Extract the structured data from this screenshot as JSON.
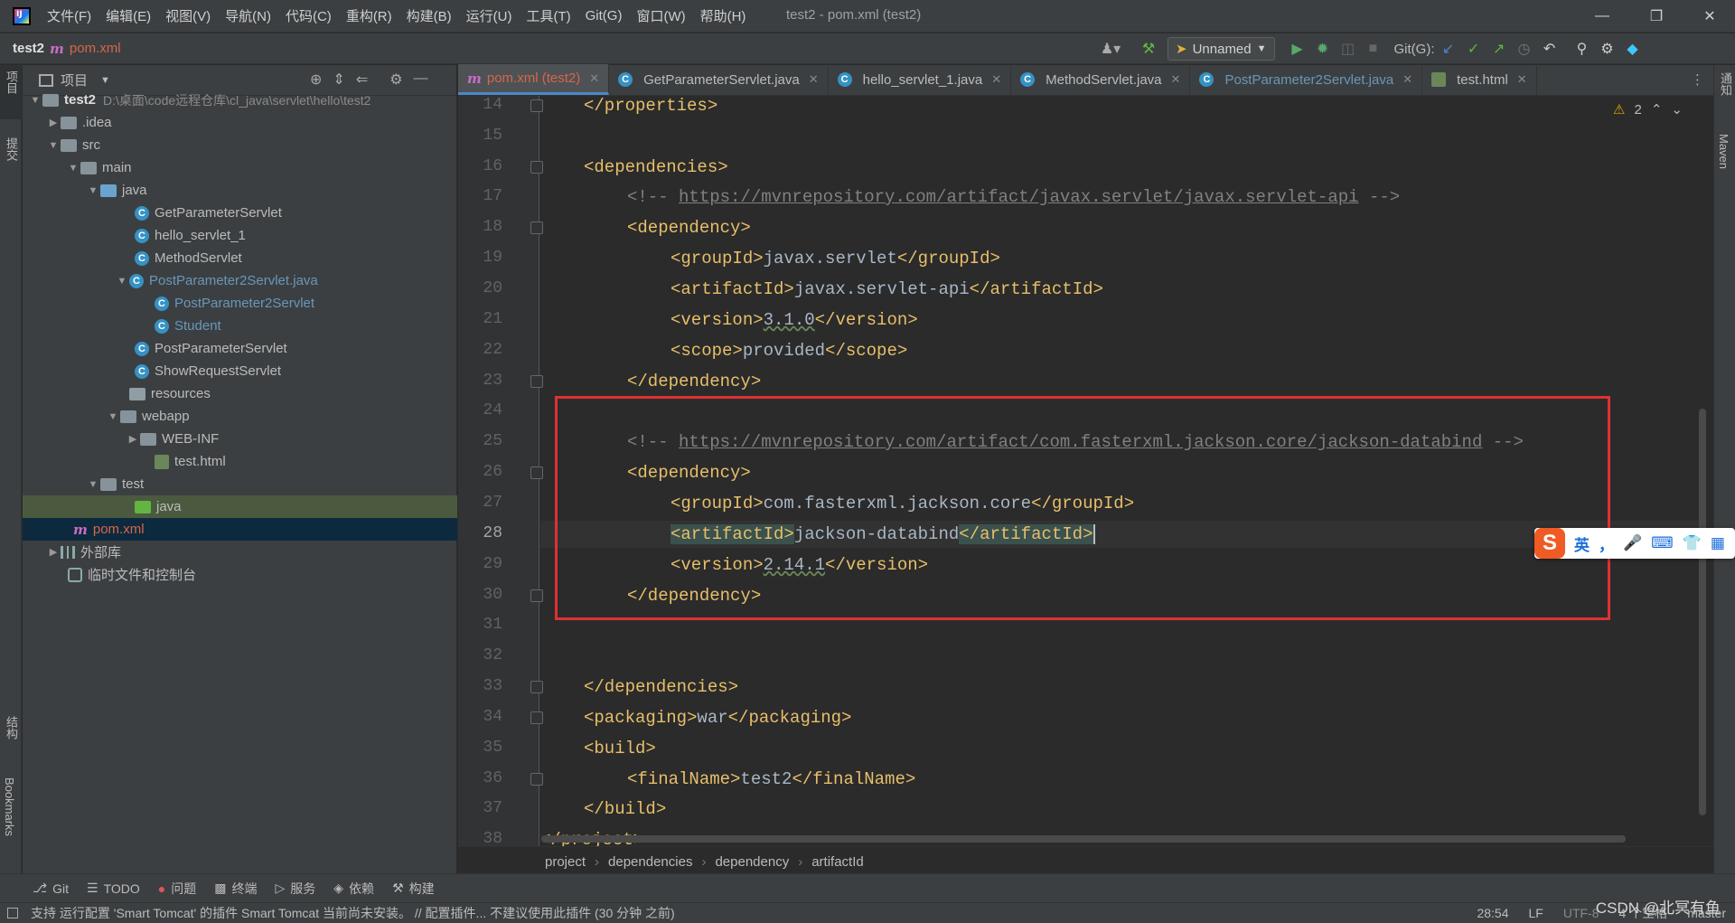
{
  "menubar": {
    "items": [
      "文件(F)",
      "编辑(E)",
      "视图(V)",
      "导航(N)",
      "代码(C)",
      "重构(R)",
      "构建(B)",
      "运行(U)",
      "工具(T)",
      "Git(G)",
      "窗口(W)",
      "帮助(H)"
    ],
    "title": "test2 - pom.xml (test2)"
  },
  "navbar": {
    "project": "test2",
    "file": "pom.xml",
    "run_config": "Unnamed",
    "git_label": "Git(G):"
  },
  "left_strip": {
    "project": "项目",
    "commit": "提交",
    "structure": "结构",
    "bookmarks": "Bookmarks"
  },
  "right_strip": {
    "notifications": "通知",
    "maven": "Maven"
  },
  "project_panel": {
    "title": "项目",
    "tree": [
      {
        "label": "test2",
        "path": "D:\\桌面\\code远程仓库\\cl_java\\servlet\\hello\\test2"
      },
      {
        "label": ".idea"
      },
      {
        "label": "src"
      },
      {
        "label": "main"
      },
      {
        "label": "java"
      },
      {
        "label": "GetParameterServlet"
      },
      {
        "label": "hello_servlet_1"
      },
      {
        "label": "MethodServlet"
      },
      {
        "label": "PostParameter2Servlet.java"
      },
      {
        "label": "PostParameter2Servlet"
      },
      {
        "label": "Student"
      },
      {
        "label": "PostParameterServlet"
      },
      {
        "label": "ShowRequestServlet"
      },
      {
        "label": "resources"
      },
      {
        "label": "webapp"
      },
      {
        "label": "WEB-INF"
      },
      {
        "label": "test.html"
      },
      {
        "label": "test"
      },
      {
        "label": "java"
      },
      {
        "label": "pom.xml"
      },
      {
        "label": "外部库"
      },
      {
        "label": "临时文件和控制台"
      }
    ]
  },
  "tabs": [
    {
      "label": "pom.xml (test2)"
    },
    {
      "label": "GetParameterServlet.java"
    },
    {
      "label": "hello_servlet_1.java"
    },
    {
      "label": "MethodServlet.java"
    },
    {
      "label": "PostParameter2Servlet.java"
    },
    {
      "label": "test.html"
    }
  ],
  "editor": {
    "warnings": "2",
    "line_numbers": [
      "14",
      "15",
      "16",
      "17",
      "18",
      "19",
      "20",
      "21",
      "22",
      "23",
      "24",
      "25",
      "26",
      "27",
      "28",
      "29",
      "30",
      "31",
      "32",
      "33",
      "34",
      "35",
      "36",
      "37",
      "38"
    ],
    "lines": {
      "l14": "</properties>",
      "l16": "<dependencies>",
      "l17_cmt_open": "<!-- ",
      "l17_url": "https://mvnrepository.com/artifact/javax.servlet/javax.servlet-api",
      "l17_cmt_close": " -->",
      "l18": "<dependency>",
      "l19_open": "<groupId>",
      "l19_val": "javax.servlet",
      "l19_close": "</groupId>",
      "l20_open": "<artifactId>",
      "l20_val": "javax.servlet-api",
      "l20_close": "</artifactId>",
      "l21_open": "<version>",
      "l21_val": "3.1.0",
      "l21_close": "</version>",
      "l22_open": "<scope>",
      "l22_val": "provided",
      "l22_close": "</scope>",
      "l23": "</dependency>",
      "l25_cmt_open": "<!-- ",
      "l25_url": "https://mvnrepository.com/artifact/com.fasterxml.jackson.core/jackson-databind",
      "l25_cmt_close": " -->",
      "l26": "<dependency>",
      "l27_open": "<groupId>",
      "l27_val": "com.fasterxml.jackson.core",
      "l27_close": "</groupId>",
      "l28_open": "<artifactId>",
      "l28_val": "jackson-databind",
      "l28_close": "</artifactId>",
      "l29_open": "<version>",
      "l29_val": "2.14.1",
      "l29_close": "</version>",
      "l30": "</dependency>",
      "l33": "</dependencies>",
      "l34_open": "<packaging>",
      "l34_val": "war",
      "l34_close": "</packaging>",
      "l35": "<build>",
      "l36_open": "<finalName>",
      "l36_val": "test2",
      "l36_close": "</finalName>",
      "l37": "</build>",
      "l38": "</project>"
    }
  },
  "breadcrumb": [
    "project",
    "dependencies",
    "dependency",
    "artifactId"
  ],
  "ime": {
    "lang": "英",
    "punct": "，"
  },
  "tool_windows": [
    "Git",
    "TODO",
    "问题",
    "终端",
    "服务",
    "依赖",
    "构建"
  ],
  "status": {
    "message": "支持 运行配置 'Smart Tomcat' 的插件 Smart Tomcat 当前尚未安装。 // 配置插件...   不建议使用此插件 (30 分钟 之前)",
    "position": "28:54",
    "line_sep": "LF",
    "encoding": "UTF-8",
    "indent": "4 个空格",
    "branch": "master",
    "watermark": "CSDN @北冥有鱼"
  },
  "colors": {
    "accent": "#4a88c7",
    "tag": "#e8bf6a",
    "highlight_box": "#e03131"
  }
}
